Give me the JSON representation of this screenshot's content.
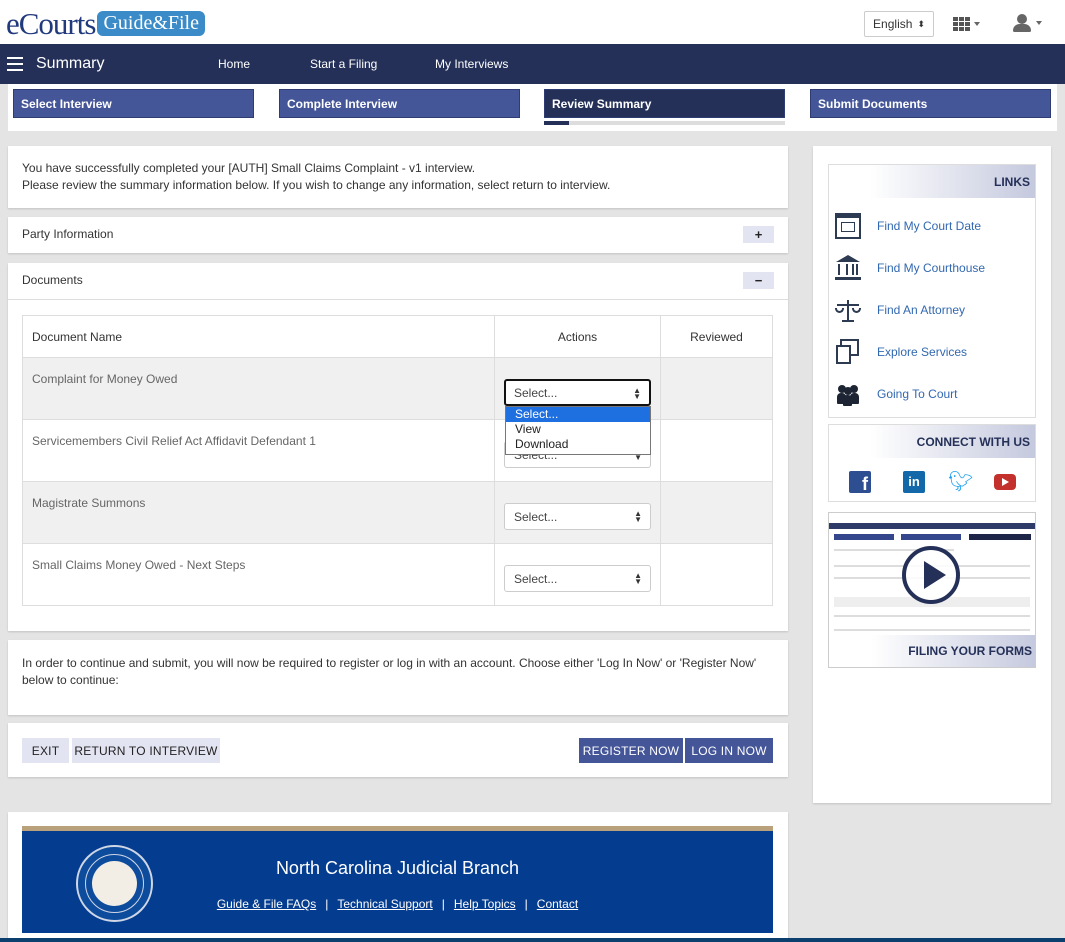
{
  "brand": {
    "name": "eCourts",
    "product": "Guide&File"
  },
  "header": {
    "language": "English"
  },
  "nav": {
    "title": "Summary",
    "links": [
      "Home",
      "Start a Filing",
      "My Interviews"
    ]
  },
  "steps": [
    {
      "label": "Select Interview"
    },
    {
      "label": "Complete Interview"
    },
    {
      "label": "Review Summary",
      "active": true
    },
    {
      "label": "Submit Documents"
    }
  ],
  "intro": {
    "line1": "You have successfully completed your [AUTH] Small Claims Complaint - v1 interview.",
    "line2": "Please review the summary information below. If you wish to change any information, select return to interview."
  },
  "sections": {
    "party": {
      "title": "Party Information",
      "toggle": "+"
    },
    "documents": {
      "title": "Documents",
      "toggle": "−"
    }
  },
  "table": {
    "headers": [
      "Document Name",
      "Actions",
      "Reviewed"
    ],
    "rows": [
      {
        "name": "Complaint for Money Owed",
        "action": "Select..."
      },
      {
        "name": "Servicemembers Civil Relief Act Affidavit Defendant 1",
        "action": "Select..."
      },
      {
        "name": "Magistrate Summons",
        "action": "Select..."
      },
      {
        "name": "Small Claims Money Owed - Next Steps",
        "action": "Select..."
      }
    ]
  },
  "dropdown": {
    "options": [
      "Select...",
      "View",
      "Download"
    ],
    "highlighted": "Select..."
  },
  "register_text": "In order to continue and submit, you will now be required to register or log in with an account. Choose either 'Log In Now' or 'Register Now' below to continue:",
  "buttons": {
    "exit": "EXIT",
    "return": "RETURN TO INTERVIEW",
    "register": "REGISTER NOW",
    "login": "LOG IN NOW"
  },
  "sidebar": {
    "links_title": "LINKS",
    "links": [
      {
        "label": "Find My Court Date",
        "icon": "calendar-icon"
      },
      {
        "label": "Find My Courthouse",
        "icon": "courthouse-icon"
      },
      {
        "label": "Find An Attorney",
        "icon": "scales-icon"
      },
      {
        "label": "Explore Services",
        "icon": "documents-icon"
      },
      {
        "label": "Going To Court",
        "icon": "people-icon"
      }
    ],
    "connect_title": "CONNECT WITH US",
    "social": [
      "facebook-icon",
      "linkedin-icon",
      "twitter-icon",
      "youtube-icon"
    ],
    "video_caption": "FILING YOUR FORMS"
  },
  "footer": {
    "title": "North Carolina Judicial Branch",
    "links": [
      "Guide & File FAQs",
      "Technical Support",
      "Help Topics",
      "Contact"
    ],
    "separator": "|"
  },
  "colors": {
    "navy": "#243058",
    "step_blue": "#445598",
    "footer_blue": "#043d8f",
    "link_blue": "#3268b0"
  }
}
